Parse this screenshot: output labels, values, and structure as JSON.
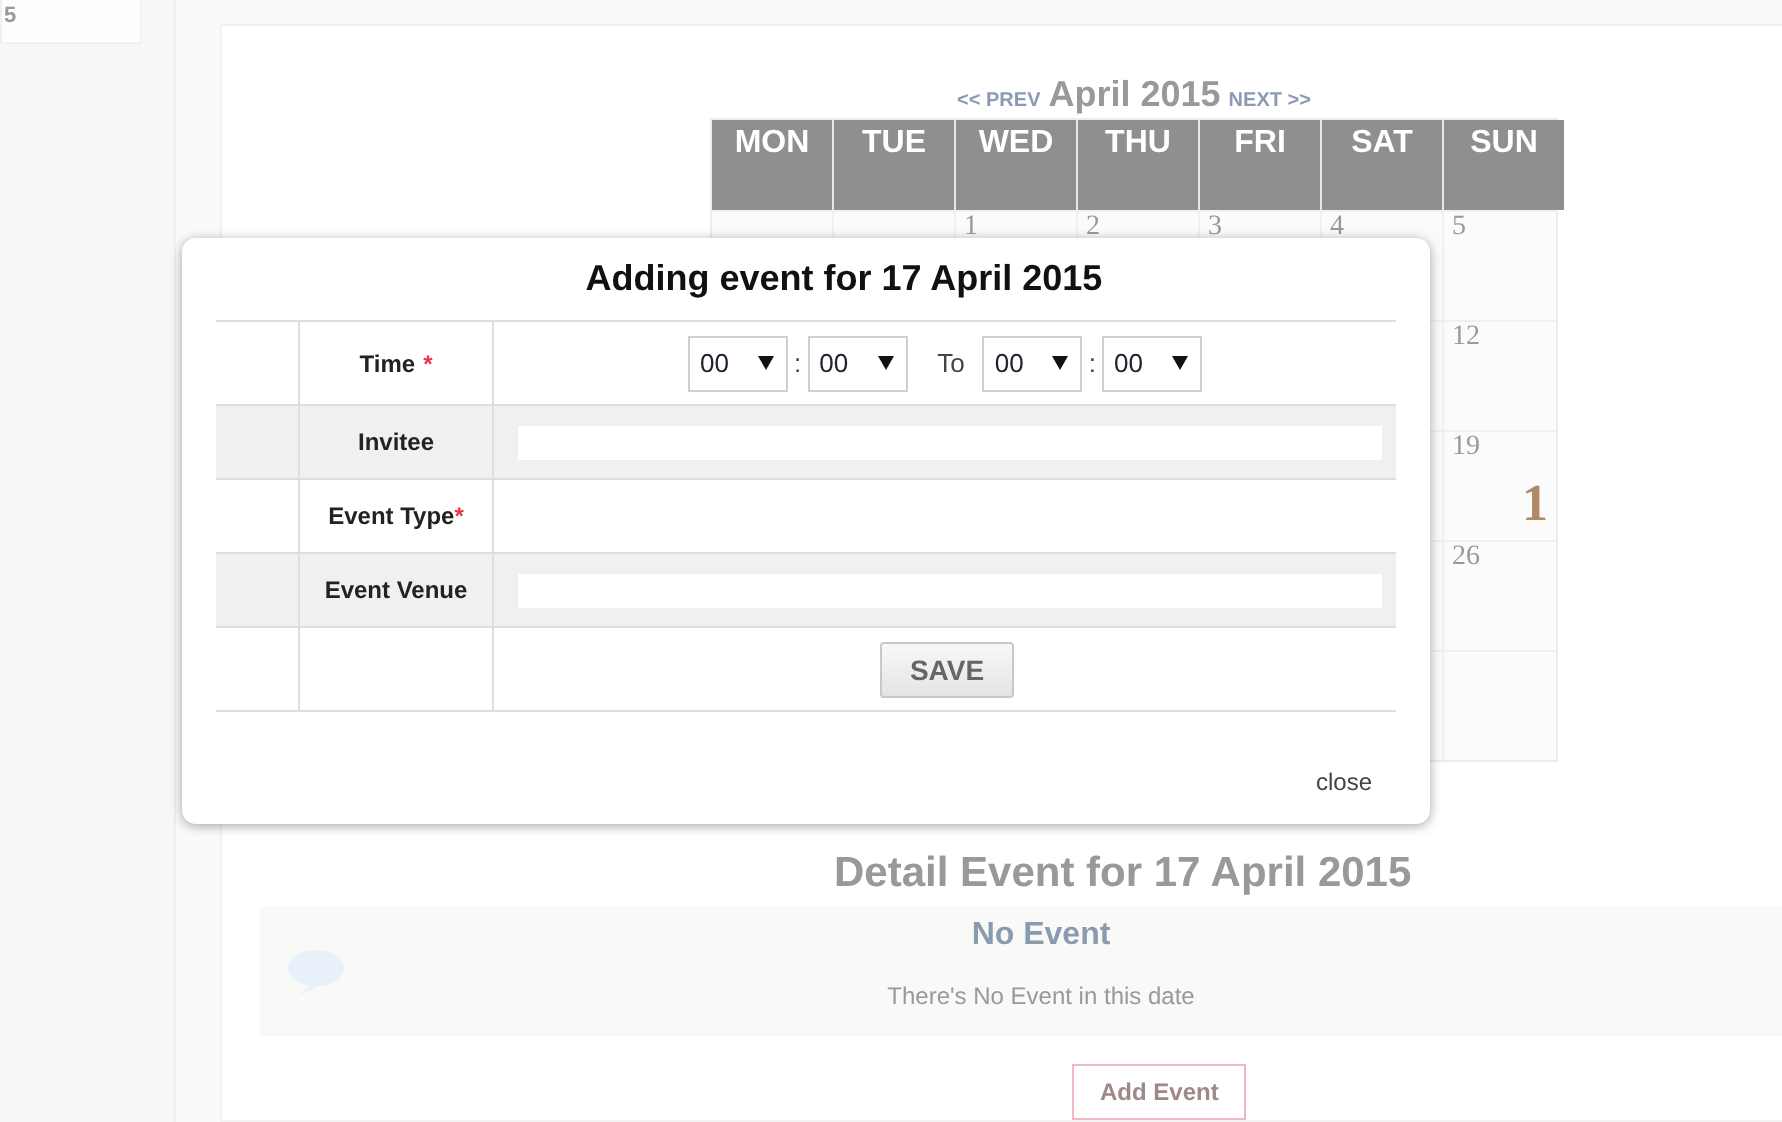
{
  "sidebar": {
    "box_text": "5"
  },
  "calendar": {
    "prev": "<< PREV",
    "month": "April 2015",
    "next": "NEXT >>",
    "weekdays": [
      "MON",
      "TUE",
      "WED",
      "THU",
      "FRI",
      "SAT",
      "SUN"
    ],
    "weeks": [
      {
        "cells": [
          {},
          {},
          {
            "day": "1"
          },
          {
            "day": "2"
          },
          {
            "day": "3"
          },
          {
            "day": "4"
          },
          {
            "day": "5"
          }
        ]
      },
      {
        "cells": [
          {},
          {},
          {},
          {},
          {},
          {},
          {
            "day": "12"
          }
        ]
      },
      {
        "cells": [
          {},
          {},
          {},
          {},
          {},
          {},
          {
            "day": "19",
            "event_count": "1"
          }
        ]
      },
      {
        "cells": [
          {},
          {},
          {},
          {},
          {},
          {},
          {
            "day": "26"
          }
        ]
      },
      {
        "cells": [
          {},
          {},
          {},
          {},
          {},
          {},
          {}
        ]
      }
    ]
  },
  "detail": {
    "title": "Detail Event for 17 April 2015",
    "heading": "No Event",
    "message": "There's No Event in this date",
    "add_button": "Add Event"
  },
  "dialog": {
    "title": "Adding event for 17 April 2015",
    "rows": [
      {
        "kind": "time",
        "label": "Time",
        "required_mark": "*",
        "from_hour": "00",
        "from_minute": "00",
        "separator": ":",
        "to_label": "To",
        "to_hour": "00",
        "to_minute": "00"
      },
      {
        "kind": "text",
        "label": "Invitee"
      },
      {
        "kind": "empty",
        "label": "Event Type",
        "required_mark": "*"
      },
      {
        "kind": "text",
        "label": "Event Venue"
      },
      {
        "kind": "button",
        "label_button": "SAVE"
      }
    ],
    "close": "close"
  }
}
